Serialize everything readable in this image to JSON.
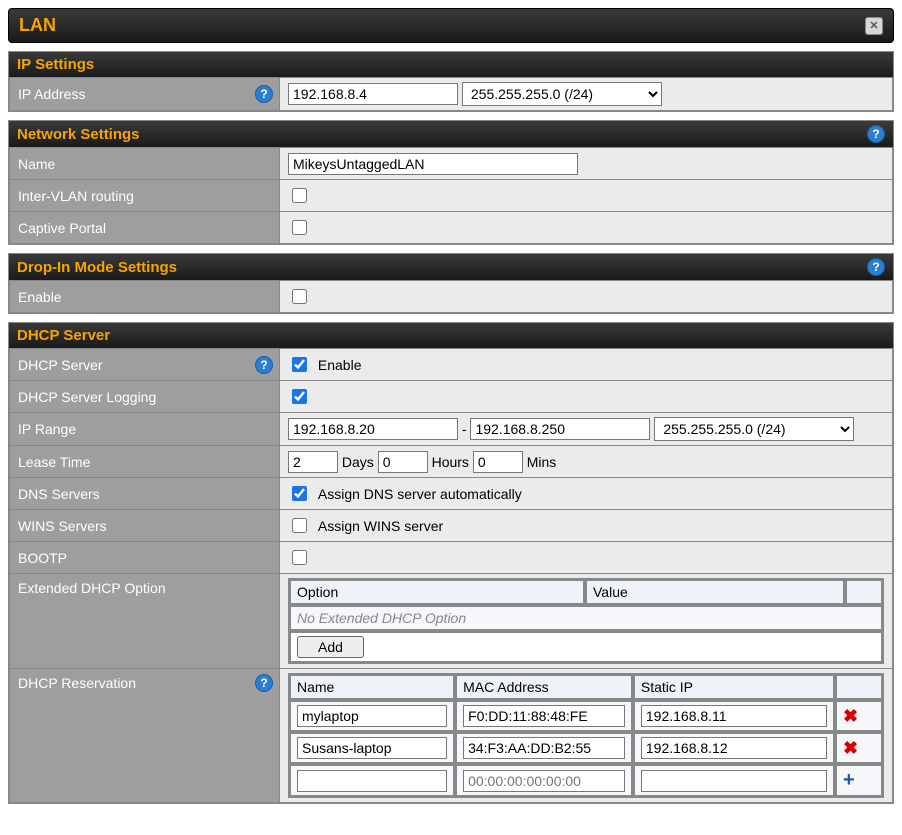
{
  "title": "LAN",
  "panels": {
    "ip": {
      "title": "IP Settings",
      "ip_label": "IP Address",
      "ip_value": "192.168.8.4",
      "mask_value": "255.255.255.0 (/24)"
    },
    "net": {
      "title": "Network Settings",
      "name_label": "Name",
      "name_value": "MikeysUntaggedLAN",
      "intervlan_label": "Inter-VLAN routing",
      "intervlan_checked": false,
      "captive_label": "Captive Portal",
      "captive_checked": false
    },
    "dropin": {
      "title": "Drop-In Mode Settings",
      "enable_label": "Enable",
      "enable_checked": false
    },
    "dhcp": {
      "title": "DHCP Server",
      "server_label": "DHCP Server",
      "server_checked": true,
      "server_text": "Enable",
      "logging_label": "DHCP Server Logging",
      "logging_checked": true,
      "range_label": "IP Range",
      "range_start": "192.168.8.20",
      "range_sep": "-",
      "range_end": "192.168.8.250",
      "range_mask": "255.255.255.0 (/24)",
      "lease_label": "Lease Time",
      "lease_days": "2",
      "lease_days_unit": "Days",
      "lease_hours": "0",
      "lease_hours_unit": "Hours",
      "lease_mins": "0",
      "lease_mins_unit": "Mins",
      "dns_label": "DNS Servers",
      "dns_checked": true,
      "dns_text": "Assign DNS server automatically",
      "wins_label": "WINS Servers",
      "wins_checked": false,
      "wins_text": "Assign WINS server",
      "bootp_label": "BOOTP",
      "bootp_checked": false,
      "ext_label": "Extended DHCP Option",
      "ext_col_option": "Option",
      "ext_col_value": "Value",
      "ext_empty": "No Extended DHCP Option",
      "ext_add": "Add",
      "res_label": "DHCP Reservation",
      "res_col_name": "Name",
      "res_col_mac": "MAC Address",
      "res_col_ip": "Static IP",
      "reservations": [
        {
          "name": "mylaptop",
          "mac": "F0:DD:11:88:48:FE",
          "ip": "192.168.8.11"
        },
        {
          "name": "Susans-laptop",
          "mac": "34:F3:AA:DD:B2:55",
          "ip": "192.168.8.12"
        }
      ],
      "res_new_mac_placeholder": "00:00:00:00:00:00"
    }
  }
}
